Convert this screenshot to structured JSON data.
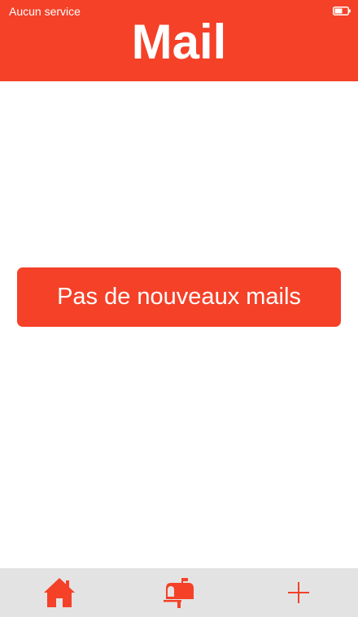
{
  "status_bar": {
    "carrier": "Aucun service",
    "battery_icon": "battery-icon"
  },
  "header": {
    "title": "Mail"
  },
  "main": {
    "empty_message": "Pas de nouveaux mails"
  },
  "tab_bar": {
    "items": [
      {
        "icon": "home-icon"
      },
      {
        "icon": "mailbox-icon"
      },
      {
        "icon": "plus-icon"
      }
    ]
  },
  "colors": {
    "accent": "#f44128",
    "tab_bar_background": "#e3e3e3",
    "text_on_accent": "#ffffff"
  }
}
